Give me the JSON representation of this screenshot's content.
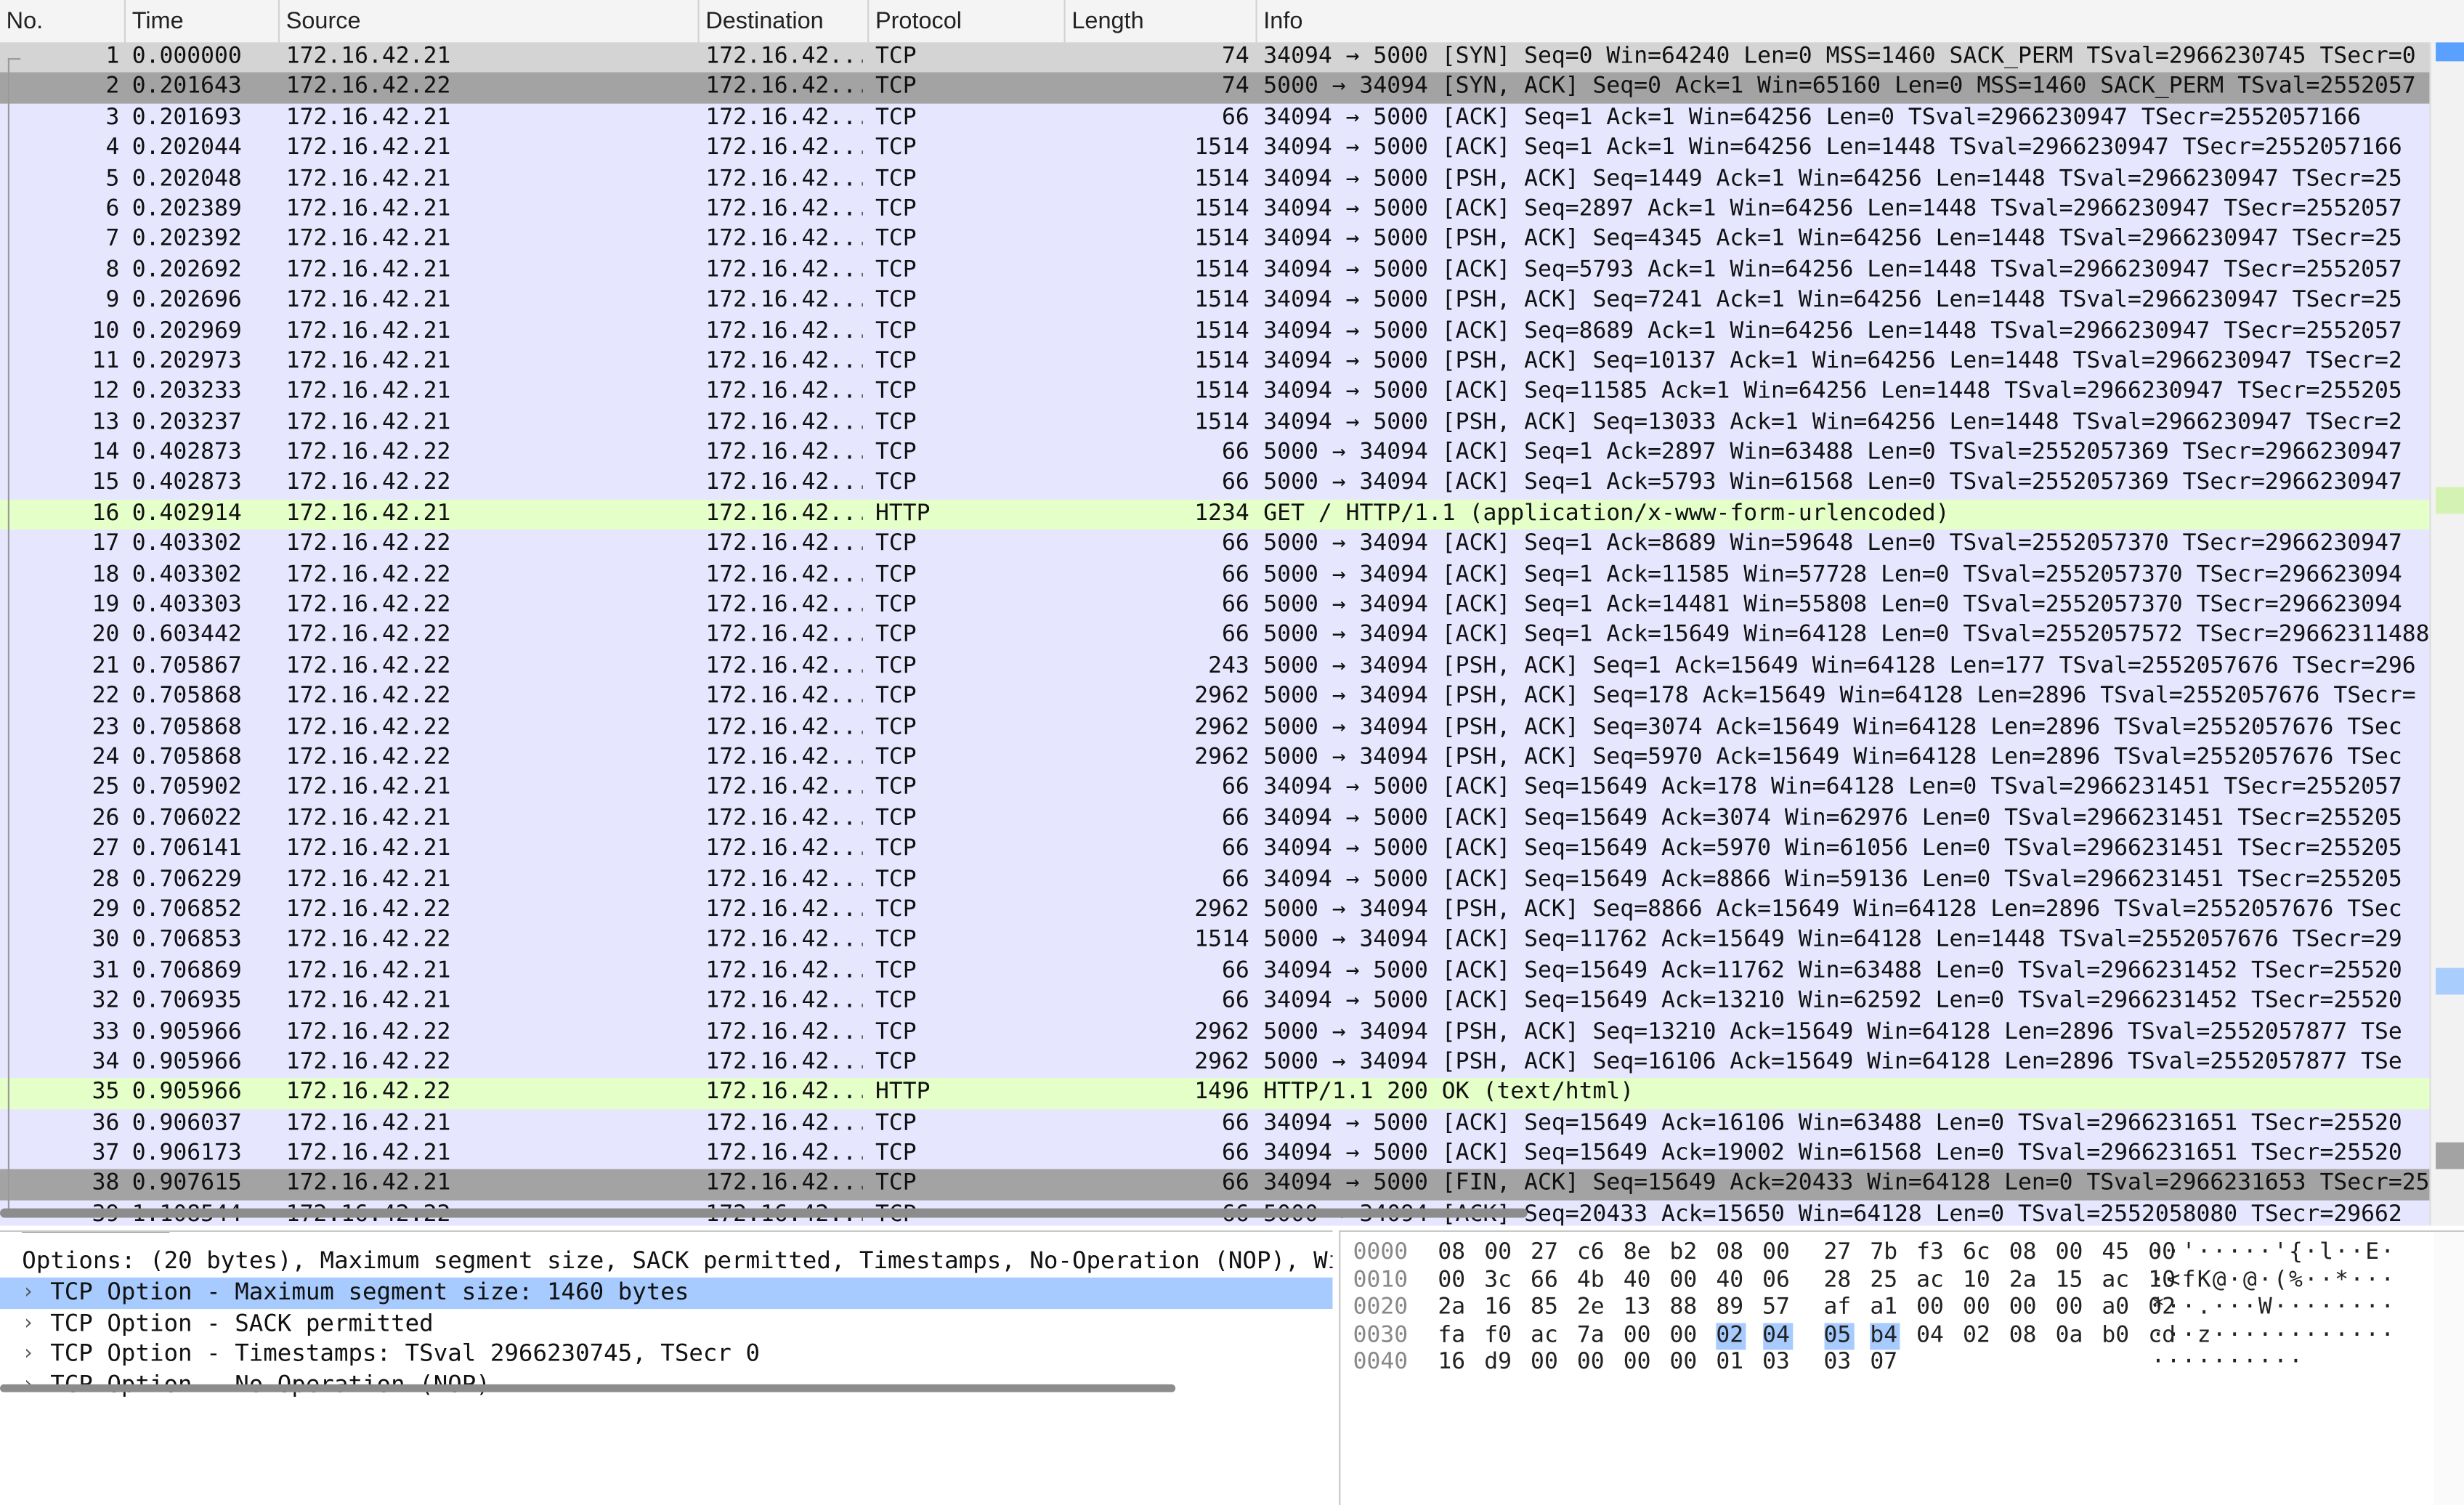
{
  "columns": {
    "no": "No.",
    "time": "Time",
    "source": "Source",
    "destination": "Destination",
    "protocol": "Protocol",
    "length": "Length",
    "info": "Info"
  },
  "packets": [
    {
      "no": "1",
      "time": "0.000000",
      "src": "172.16.42.21",
      "dst": "172.16.42...",
      "proto": "TCP",
      "len": "74",
      "info": "34094 → 5000 [SYN] Seq=0 Win=64240 Len=0 MSS=1460 SACK_PERM TSval=2966230745 TSecr=0"
    },
    {
      "no": "2",
      "time": "0.201643",
      "src": "172.16.42.22",
      "dst": "172.16.42...",
      "proto": "TCP",
      "len": "74",
      "info": "5000 → 34094 [SYN, ACK] Seq=0 Ack=1 Win=65160 Len=0 MSS=1460 SACK_PERM TSval=2552057"
    },
    {
      "no": "3",
      "time": "0.201693",
      "src": "172.16.42.21",
      "dst": "172.16.42...",
      "proto": "TCP",
      "len": "66",
      "info": "34094 → 5000 [ACK] Seq=1 Ack=1 Win=64256 Len=0 TSval=2966230947 TSecr=2552057166"
    },
    {
      "no": "4",
      "time": "0.202044",
      "src": "172.16.42.21",
      "dst": "172.16.42...",
      "proto": "TCP",
      "len": "1514",
      "info": "34094 → 5000 [ACK] Seq=1 Ack=1 Win=64256 Len=1448 TSval=2966230947 TSecr=2552057166"
    },
    {
      "no": "5",
      "time": "0.202048",
      "src": "172.16.42.21",
      "dst": "172.16.42...",
      "proto": "TCP",
      "len": "1514",
      "info": "34094 → 5000 [PSH, ACK] Seq=1449 Ack=1 Win=64256 Len=1448 TSval=2966230947 TSecr=25"
    },
    {
      "no": "6",
      "time": "0.202389",
      "src": "172.16.42.21",
      "dst": "172.16.42...",
      "proto": "TCP",
      "len": "1514",
      "info": "34094 → 5000 [ACK] Seq=2897 Ack=1 Win=64256 Len=1448 TSval=2966230947 TSecr=2552057"
    },
    {
      "no": "7",
      "time": "0.202392",
      "src": "172.16.42.21",
      "dst": "172.16.42...",
      "proto": "TCP",
      "len": "1514",
      "info": "34094 → 5000 [PSH, ACK] Seq=4345 Ack=1 Win=64256 Len=1448 TSval=2966230947 TSecr=25"
    },
    {
      "no": "8",
      "time": "0.202692",
      "src": "172.16.42.21",
      "dst": "172.16.42...",
      "proto": "TCP",
      "len": "1514",
      "info": "34094 → 5000 [ACK] Seq=5793 Ack=1 Win=64256 Len=1448 TSval=2966230947 TSecr=2552057"
    },
    {
      "no": "9",
      "time": "0.202696",
      "src": "172.16.42.21",
      "dst": "172.16.42...",
      "proto": "TCP",
      "len": "1514",
      "info": "34094 → 5000 [PSH, ACK] Seq=7241 Ack=1 Win=64256 Len=1448 TSval=2966230947 TSecr=25"
    },
    {
      "no": "10",
      "time": "0.202969",
      "src": "172.16.42.21",
      "dst": "172.16.42...",
      "proto": "TCP",
      "len": "1514",
      "info": "34094 → 5000 [ACK] Seq=8689 Ack=1 Win=64256 Len=1448 TSval=2966230947 TSecr=2552057"
    },
    {
      "no": "11",
      "time": "0.202973",
      "src": "172.16.42.21",
      "dst": "172.16.42...",
      "proto": "TCP",
      "len": "1514",
      "info": "34094 → 5000 [PSH, ACK] Seq=10137 Ack=1 Win=64256 Len=1448 TSval=2966230947 TSecr=2"
    },
    {
      "no": "12",
      "time": "0.203233",
      "src": "172.16.42.21",
      "dst": "172.16.42...",
      "proto": "TCP",
      "len": "1514",
      "info": "34094 → 5000 [ACK] Seq=11585 Ack=1 Win=64256 Len=1448 TSval=2966230947 TSecr=255205"
    },
    {
      "no": "13",
      "time": "0.203237",
      "src": "172.16.42.21",
      "dst": "172.16.42...",
      "proto": "TCP",
      "len": "1514",
      "info": "34094 → 5000 [PSH, ACK] Seq=13033 Ack=1 Win=64256 Len=1448 TSval=2966230947 TSecr=2"
    },
    {
      "no": "14",
      "time": "0.402873",
      "src": "172.16.42.22",
      "dst": "172.16.42...",
      "proto": "TCP",
      "len": "66",
      "info": "5000 → 34094 [ACK] Seq=1 Ack=2897 Win=63488 Len=0 TSval=2552057369 TSecr=2966230947"
    },
    {
      "no": "15",
      "time": "0.402873",
      "src": "172.16.42.22",
      "dst": "172.16.42...",
      "proto": "TCP",
      "len": "66",
      "info": "5000 → 34094 [ACK] Seq=1 Ack=5793 Win=61568 Len=0 TSval=2552057369 TSecr=2966230947"
    },
    {
      "no": "16",
      "time": "0.402914",
      "src": "172.16.42.21",
      "dst": "172.16.42...",
      "proto": "HTTP",
      "len": "1234",
      "info": "GET / HTTP/1.1  (application/x-www-form-urlencoded)"
    },
    {
      "no": "17",
      "time": "0.403302",
      "src": "172.16.42.22",
      "dst": "172.16.42...",
      "proto": "TCP",
      "len": "66",
      "info": "5000 → 34094 [ACK] Seq=1 Ack=8689 Win=59648 Len=0 TSval=2552057370 TSecr=2966230947"
    },
    {
      "no": "18",
      "time": "0.403302",
      "src": "172.16.42.22",
      "dst": "172.16.42...",
      "proto": "TCP",
      "len": "66",
      "info": "5000 → 34094 [ACK] Seq=1 Ack=11585 Win=57728 Len=0 TSval=2552057370 TSecr=296623094"
    },
    {
      "no": "19",
      "time": "0.403303",
      "src": "172.16.42.22",
      "dst": "172.16.42...",
      "proto": "TCP",
      "len": "66",
      "info": "5000 → 34094 [ACK] Seq=1 Ack=14481 Win=55808 Len=0 TSval=2552057370 TSecr=296623094"
    },
    {
      "no": "20",
      "time": "0.603442",
      "src": "172.16.42.22",
      "dst": "172.16.42...",
      "proto": "TCP",
      "len": "66",
      "info": "5000 → 34094 [ACK] Seq=1 Ack=15649 Win=64128 Len=0 TSval=2552057572 TSecr=29662311488"
    },
    {
      "no": "21",
      "time": "0.705867",
      "src": "172.16.42.22",
      "dst": "172.16.42...",
      "proto": "TCP",
      "len": "243",
      "info": "5000 → 34094 [PSH, ACK] Seq=1 Ack=15649 Win=64128 Len=177 TSval=2552057676 TSecr=296"
    },
    {
      "no": "22",
      "time": "0.705868",
      "src": "172.16.42.22",
      "dst": "172.16.42...",
      "proto": "TCP",
      "len": "2962",
      "info": "5000 → 34094 [PSH, ACK] Seq=178 Ack=15649 Win=64128 Len=2896 TSval=2552057676 TSecr="
    },
    {
      "no": "23",
      "time": "0.705868",
      "src": "172.16.42.22",
      "dst": "172.16.42...",
      "proto": "TCP",
      "len": "2962",
      "info": "5000 → 34094 [PSH, ACK] Seq=3074 Ack=15649 Win=64128 Len=2896 TSval=2552057676 TSec"
    },
    {
      "no": "24",
      "time": "0.705868",
      "src": "172.16.42.22",
      "dst": "172.16.42...",
      "proto": "TCP",
      "len": "2962",
      "info": "5000 → 34094 [PSH, ACK] Seq=5970 Ack=15649 Win=64128 Len=2896 TSval=2552057676 TSec"
    },
    {
      "no": "25",
      "time": "0.705902",
      "src": "172.16.42.21",
      "dst": "172.16.42...",
      "proto": "TCP",
      "len": "66",
      "info": "34094 → 5000 [ACK] Seq=15649 Ack=178 Win=64128 Len=0 TSval=2966231451 TSecr=2552057"
    },
    {
      "no": "26",
      "time": "0.706022",
      "src": "172.16.42.21",
      "dst": "172.16.42...",
      "proto": "TCP",
      "len": "66",
      "info": "34094 → 5000 [ACK] Seq=15649 Ack=3074 Win=62976 Len=0 TSval=2966231451 TSecr=255205"
    },
    {
      "no": "27",
      "time": "0.706141",
      "src": "172.16.42.21",
      "dst": "172.16.42...",
      "proto": "TCP",
      "len": "66",
      "info": "34094 → 5000 [ACK] Seq=15649 Ack=5970 Win=61056 Len=0 TSval=2966231451 TSecr=255205"
    },
    {
      "no": "28",
      "time": "0.706229",
      "src": "172.16.42.21",
      "dst": "172.16.42...",
      "proto": "TCP",
      "len": "66",
      "info": "34094 → 5000 [ACK] Seq=15649 Ack=8866 Win=59136 Len=0 TSval=2966231451 TSecr=255205"
    },
    {
      "no": "29",
      "time": "0.706852",
      "src": "172.16.42.22",
      "dst": "172.16.42...",
      "proto": "TCP",
      "len": "2962",
      "info": "5000 → 34094 [PSH, ACK] Seq=8866 Ack=15649 Win=64128 Len=2896 TSval=2552057676 TSec"
    },
    {
      "no": "30",
      "time": "0.706853",
      "src": "172.16.42.22",
      "dst": "172.16.42...",
      "proto": "TCP",
      "len": "1514",
      "info": "5000 → 34094 [ACK] Seq=11762 Ack=15649 Win=64128 Len=1448 TSval=2552057676 TSecr=29"
    },
    {
      "no": "31",
      "time": "0.706869",
      "src": "172.16.42.21",
      "dst": "172.16.42...",
      "proto": "TCP",
      "len": "66",
      "info": "34094 → 5000 [ACK] Seq=15649 Ack=11762 Win=63488 Len=0 TSval=2966231452 TSecr=25520"
    },
    {
      "no": "32",
      "time": "0.706935",
      "src": "172.16.42.21",
      "dst": "172.16.42...",
      "proto": "TCP",
      "len": "66",
      "info": "34094 → 5000 [ACK] Seq=15649 Ack=13210 Win=62592 Len=0 TSval=2966231452 TSecr=25520"
    },
    {
      "no": "33",
      "time": "0.905966",
      "src": "172.16.42.22",
      "dst": "172.16.42...",
      "proto": "TCP",
      "len": "2962",
      "info": "5000 → 34094 [PSH, ACK] Seq=13210 Ack=15649 Win=64128 Len=2896 TSval=2552057877 TSe"
    },
    {
      "no": "34",
      "time": "0.905966",
      "src": "172.16.42.22",
      "dst": "172.16.42...",
      "proto": "TCP",
      "len": "2962",
      "info": "5000 → 34094 [PSH, ACK] Seq=16106 Ack=15649 Win=64128 Len=2896 TSval=2552057877 TSe"
    },
    {
      "no": "35",
      "time": "0.905966",
      "src": "172.16.42.22",
      "dst": "172.16.42...",
      "proto": "HTTP",
      "len": "1496",
      "info": "HTTP/1.1 200 OK  (text/html)"
    },
    {
      "no": "36",
      "time": "0.906037",
      "src": "172.16.42.21",
      "dst": "172.16.42...",
      "proto": "TCP",
      "len": "66",
      "info": "34094 → 5000 [ACK] Seq=15649 Ack=16106 Win=63488 Len=0 TSval=2966231651 TSecr=25520"
    },
    {
      "no": "37",
      "time": "0.906173",
      "src": "172.16.42.21",
      "dst": "172.16.42...",
      "proto": "TCP",
      "len": "66",
      "info": "34094 → 5000 [ACK] Seq=15649 Ack=19002 Win=61568 Len=0 TSval=2966231651 TSecr=25520"
    },
    {
      "no": "38",
      "time": "0.907615",
      "src": "172.16.42.21",
      "dst": "172.16.42...",
      "proto": "TCP",
      "len": "66",
      "info": "34094 → 5000 [FIN, ACK] Seq=15649 Ack=20433 Win=64128 Len=0 TSval=2966231653 TSecr=25"
    },
    {
      "no": "39",
      "time": "1.108544",
      "src": "172.16.42.22",
      "dst": "172.16.42...",
      "proto": "TCP",
      "len": "66",
      "info": "5000 → 34094 [ACK] Seq=20433 Ack=15650 Win=64128 Len=0 TSval=2552058080 TSecr=29662"
    }
  ],
  "row_colors": {
    "tcp": "#e7e6ff",
    "http": "#e4ffc7",
    "selected": "#a3a3a3",
    "focused": "#d4d4d4",
    "detail_selected": "#a7cbff"
  },
  "detail": {
    "options_line": "Options: (20 bytes), Maximum segment size, SACK permitted, Timestamps, No-Operation (NOP), Wi",
    "items": [
      {
        "arrow": "›",
        "text": "TCP Option - Maximum segment size: 1460 bytes",
        "selected": true
      },
      {
        "arrow": "›",
        "text": "TCP Option - SACK permitted",
        "selected": false
      },
      {
        "arrow": "›",
        "text": "TCP Option - Timestamps: TSval 2966230745, TSecr 0",
        "selected": false
      },
      {
        "arrow": "›",
        "text": "TCP Option - No-Operation (NOP)",
        "selected": false
      }
    ]
  },
  "bytes": [
    {
      "offset": "0000",
      "hex": [
        "08",
        "00",
        "27",
        "c6",
        "8e",
        "b2",
        "08",
        "00",
        "27",
        "7b",
        "f3",
        "6c",
        "08",
        "00",
        "45",
        "00"
      ],
      "ascii": "··'·····'{·l··E·"
    },
    {
      "offset": "0010",
      "hex": [
        "00",
        "3c",
        "66",
        "4b",
        "40",
        "00",
        "40",
        "06",
        "28",
        "25",
        "ac",
        "10",
        "2a",
        "15",
        "ac",
        "10"
      ],
      "ascii": "·<fK@·@·(%··*···"
    },
    {
      "offset": "0020",
      "hex": [
        "2a",
        "16",
        "85",
        "2e",
        "13",
        "88",
        "89",
        "57",
        "af",
        "a1",
        "00",
        "00",
        "00",
        "00",
        "a0",
        "02"
      ],
      "ascii": "*··.···W········"
    },
    {
      "offset": "0030",
      "hex": [
        "fa",
        "f0",
        "ac",
        "7a",
        "00",
        "00",
        "02",
        "04",
        "05",
        "b4",
        "04",
        "02",
        "08",
        "0a",
        "b0",
        "cd"
      ],
      "ascii": "···z············",
      "highlight": [
        6,
        7,
        8,
        9
      ]
    },
    {
      "offset": "0040",
      "hex": [
        "16",
        "d9",
        "00",
        "00",
        "00",
        "00",
        "01",
        "03",
        "03",
        "07"
      ],
      "ascii": "··········"
    }
  ]
}
